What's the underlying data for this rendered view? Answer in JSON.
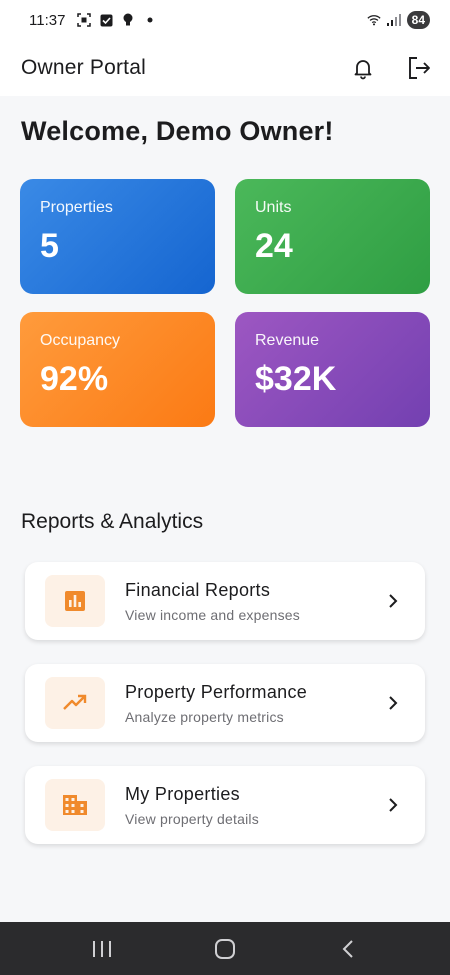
{
  "status_bar": {
    "time": "11:37",
    "battery": "84",
    "icons": [
      "screenshot-icon",
      "check-box-icon",
      "bulb-icon",
      "dot-icon",
      "wifi-icon",
      "signal-icon"
    ]
  },
  "app_bar": {
    "title": "Owner Portal",
    "icons": [
      "bell-icon",
      "logout-icon"
    ]
  },
  "welcome": "Welcome, Demo Owner!",
  "stats": [
    {
      "label": "Properties",
      "value": "5",
      "color": "#1f6fd8"
    },
    {
      "label": "Units",
      "value": "24",
      "color": "#3aa84b"
    },
    {
      "label": "Occupancy",
      "value": "92%",
      "color": "#fd8a24"
    },
    {
      "label": "Revenue",
      "value": "$32K",
      "color": "#8a4cbb"
    }
  ],
  "section_title": "Reports & Analytics",
  "reports": [
    {
      "title": "Financial Reports",
      "subtitle": "View income and expenses",
      "icon": "bar-chart-icon"
    },
    {
      "title": "Property Performance",
      "subtitle": "Analyze property metrics",
      "icon": "trending-up-icon"
    },
    {
      "title": "My Properties",
      "subtitle": "View property details",
      "icon": "building-icon"
    }
  ],
  "accent_color": "#f08a2c",
  "nav_bar": {
    "buttons": [
      "recent-apps-icon",
      "home-icon",
      "back-icon"
    ]
  }
}
